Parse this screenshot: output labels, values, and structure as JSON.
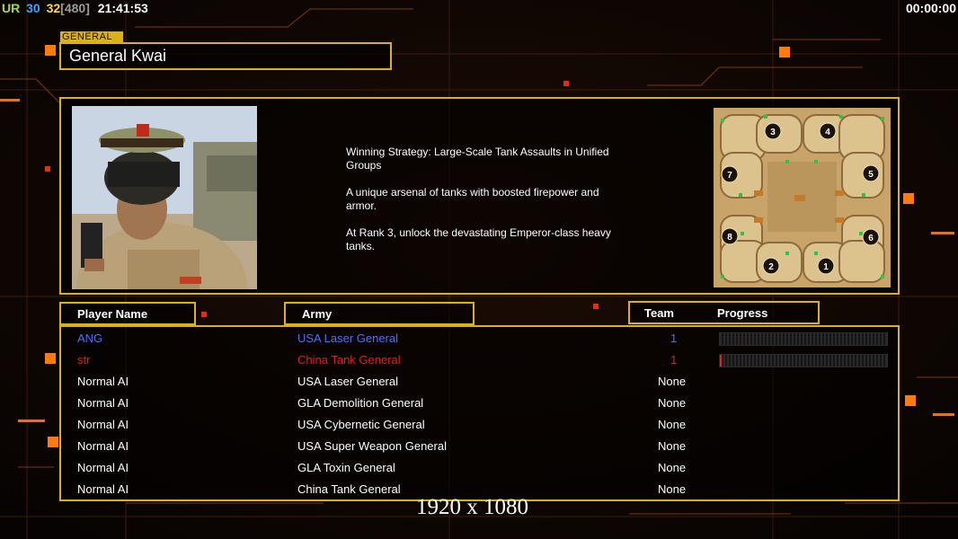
{
  "status_bar": {
    "tag": "UR",
    "val_a": "30",
    "val_b": "32",
    "val_c": "[480]",
    "clock": "21:41:53",
    "timer": "00:00:00"
  },
  "general": {
    "tag": "GENERAL",
    "name": "General Kwai",
    "description": "Winning Strategy: Large-Scale Tank Assaults in Unified\n Groups\n\nA unique arsenal of tanks with boosted firepower and\n armor.\n\nAt Rank 3, unlock the devastating Emperor-class heavy\n tanks."
  },
  "map": {
    "start_positions": [
      "1",
      "2",
      "3",
      "4",
      "5",
      "6",
      "7",
      "8"
    ]
  },
  "table": {
    "headers": {
      "player": "Player Name",
      "army": "Army",
      "team": "Team",
      "progress": "Progress"
    },
    "rows": [
      {
        "name": "ANG",
        "army": "USA Laser General",
        "team": "1",
        "color": "#4d6eff",
        "progress": 0.0
      },
      {
        "name": "str",
        "army": "China Tank General",
        "team": "1",
        "color": "#e02020",
        "progress": 0.01
      },
      {
        "name": "Normal AI",
        "army": "USA Laser General",
        "team": "None",
        "color": "#ffffff"
      },
      {
        "name": "Normal AI",
        "army": "GLA Demolition General",
        "team": "None",
        "color": "#ffffff"
      },
      {
        "name": "Normal AI",
        "army": "USA Cybernetic General",
        "team": "None",
        "color": "#ffffff"
      },
      {
        "name": "Normal AI",
        "army": "USA Super Weapon General",
        "team": "None",
        "color": "#ffffff"
      },
      {
        "name": "Normal AI",
        "army": "GLA Toxin General",
        "team": "None",
        "color": "#ffffff"
      },
      {
        "name": "Normal AI",
        "army": "China Tank General",
        "team": "None",
        "color": "#ffffff"
      }
    ]
  },
  "resolution_label": "1920 x 1080",
  "colors": {
    "accent": "#d9b21a",
    "glow": "#ff7a10"
  }
}
